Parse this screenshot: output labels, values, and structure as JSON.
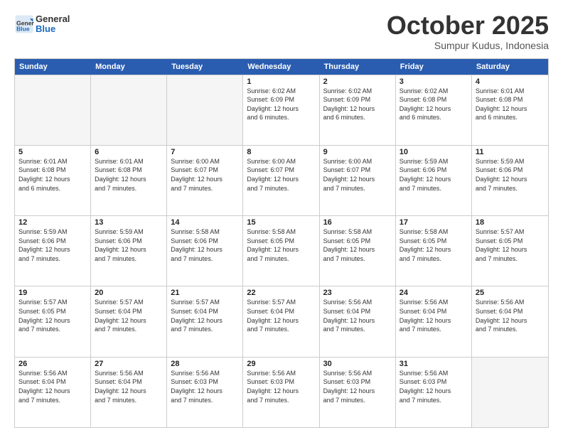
{
  "header": {
    "logo": {
      "general": "General",
      "blue": "Blue"
    },
    "title": "October 2025",
    "subtitle": "Sumpur Kudus, Indonesia"
  },
  "weekdays": [
    "Sunday",
    "Monday",
    "Tuesday",
    "Wednesday",
    "Thursday",
    "Friday",
    "Saturday"
  ],
  "rows": [
    [
      {
        "day": "",
        "info": "",
        "empty": true
      },
      {
        "day": "",
        "info": "",
        "empty": true
      },
      {
        "day": "",
        "info": "",
        "empty": true
      },
      {
        "day": "1",
        "info": "Sunrise: 6:02 AM\nSunset: 6:09 PM\nDaylight: 12 hours\nand 6 minutes.",
        "empty": false
      },
      {
        "day": "2",
        "info": "Sunrise: 6:02 AM\nSunset: 6:09 PM\nDaylight: 12 hours\nand 6 minutes.",
        "empty": false
      },
      {
        "day": "3",
        "info": "Sunrise: 6:02 AM\nSunset: 6:08 PM\nDaylight: 12 hours\nand 6 minutes.",
        "empty": false
      },
      {
        "day": "4",
        "info": "Sunrise: 6:01 AM\nSunset: 6:08 PM\nDaylight: 12 hours\nand 6 minutes.",
        "empty": false
      }
    ],
    [
      {
        "day": "5",
        "info": "Sunrise: 6:01 AM\nSunset: 6:08 PM\nDaylight: 12 hours\nand 6 minutes.",
        "empty": false
      },
      {
        "day": "6",
        "info": "Sunrise: 6:01 AM\nSunset: 6:08 PM\nDaylight: 12 hours\nand 7 minutes.",
        "empty": false
      },
      {
        "day": "7",
        "info": "Sunrise: 6:00 AM\nSunset: 6:07 PM\nDaylight: 12 hours\nand 7 minutes.",
        "empty": false
      },
      {
        "day": "8",
        "info": "Sunrise: 6:00 AM\nSunset: 6:07 PM\nDaylight: 12 hours\nand 7 minutes.",
        "empty": false
      },
      {
        "day": "9",
        "info": "Sunrise: 6:00 AM\nSunset: 6:07 PM\nDaylight: 12 hours\nand 7 minutes.",
        "empty": false
      },
      {
        "day": "10",
        "info": "Sunrise: 5:59 AM\nSunset: 6:06 PM\nDaylight: 12 hours\nand 7 minutes.",
        "empty": false
      },
      {
        "day": "11",
        "info": "Sunrise: 5:59 AM\nSunset: 6:06 PM\nDaylight: 12 hours\nand 7 minutes.",
        "empty": false
      }
    ],
    [
      {
        "day": "12",
        "info": "Sunrise: 5:59 AM\nSunset: 6:06 PM\nDaylight: 12 hours\nand 7 minutes.",
        "empty": false
      },
      {
        "day": "13",
        "info": "Sunrise: 5:59 AM\nSunset: 6:06 PM\nDaylight: 12 hours\nand 7 minutes.",
        "empty": false
      },
      {
        "day": "14",
        "info": "Sunrise: 5:58 AM\nSunset: 6:06 PM\nDaylight: 12 hours\nand 7 minutes.",
        "empty": false
      },
      {
        "day": "15",
        "info": "Sunrise: 5:58 AM\nSunset: 6:05 PM\nDaylight: 12 hours\nand 7 minutes.",
        "empty": false
      },
      {
        "day": "16",
        "info": "Sunrise: 5:58 AM\nSunset: 6:05 PM\nDaylight: 12 hours\nand 7 minutes.",
        "empty": false
      },
      {
        "day": "17",
        "info": "Sunrise: 5:58 AM\nSunset: 6:05 PM\nDaylight: 12 hours\nand 7 minutes.",
        "empty": false
      },
      {
        "day": "18",
        "info": "Sunrise: 5:57 AM\nSunset: 6:05 PM\nDaylight: 12 hours\nand 7 minutes.",
        "empty": false
      }
    ],
    [
      {
        "day": "19",
        "info": "Sunrise: 5:57 AM\nSunset: 6:05 PM\nDaylight: 12 hours\nand 7 minutes.",
        "empty": false
      },
      {
        "day": "20",
        "info": "Sunrise: 5:57 AM\nSunset: 6:04 PM\nDaylight: 12 hours\nand 7 minutes.",
        "empty": false
      },
      {
        "day": "21",
        "info": "Sunrise: 5:57 AM\nSunset: 6:04 PM\nDaylight: 12 hours\nand 7 minutes.",
        "empty": false
      },
      {
        "day": "22",
        "info": "Sunrise: 5:57 AM\nSunset: 6:04 PM\nDaylight: 12 hours\nand 7 minutes.",
        "empty": false
      },
      {
        "day": "23",
        "info": "Sunrise: 5:56 AM\nSunset: 6:04 PM\nDaylight: 12 hours\nand 7 minutes.",
        "empty": false
      },
      {
        "day": "24",
        "info": "Sunrise: 5:56 AM\nSunset: 6:04 PM\nDaylight: 12 hours\nand 7 minutes.",
        "empty": false
      },
      {
        "day": "25",
        "info": "Sunrise: 5:56 AM\nSunset: 6:04 PM\nDaylight: 12 hours\nand 7 minutes.",
        "empty": false
      }
    ],
    [
      {
        "day": "26",
        "info": "Sunrise: 5:56 AM\nSunset: 6:04 PM\nDaylight: 12 hours\nand 7 minutes.",
        "empty": false
      },
      {
        "day": "27",
        "info": "Sunrise: 5:56 AM\nSunset: 6:04 PM\nDaylight: 12 hours\nand 7 minutes.",
        "empty": false
      },
      {
        "day": "28",
        "info": "Sunrise: 5:56 AM\nSunset: 6:03 PM\nDaylight: 12 hours\nand 7 minutes.",
        "empty": false
      },
      {
        "day": "29",
        "info": "Sunrise: 5:56 AM\nSunset: 6:03 PM\nDaylight: 12 hours\nand 7 minutes.",
        "empty": false
      },
      {
        "day": "30",
        "info": "Sunrise: 5:56 AM\nSunset: 6:03 PM\nDaylight: 12 hours\nand 7 minutes.",
        "empty": false
      },
      {
        "day": "31",
        "info": "Sunrise: 5:56 AM\nSunset: 6:03 PM\nDaylight: 12 hours\nand 7 minutes.",
        "empty": false
      },
      {
        "day": "",
        "info": "",
        "empty": true
      }
    ]
  ]
}
